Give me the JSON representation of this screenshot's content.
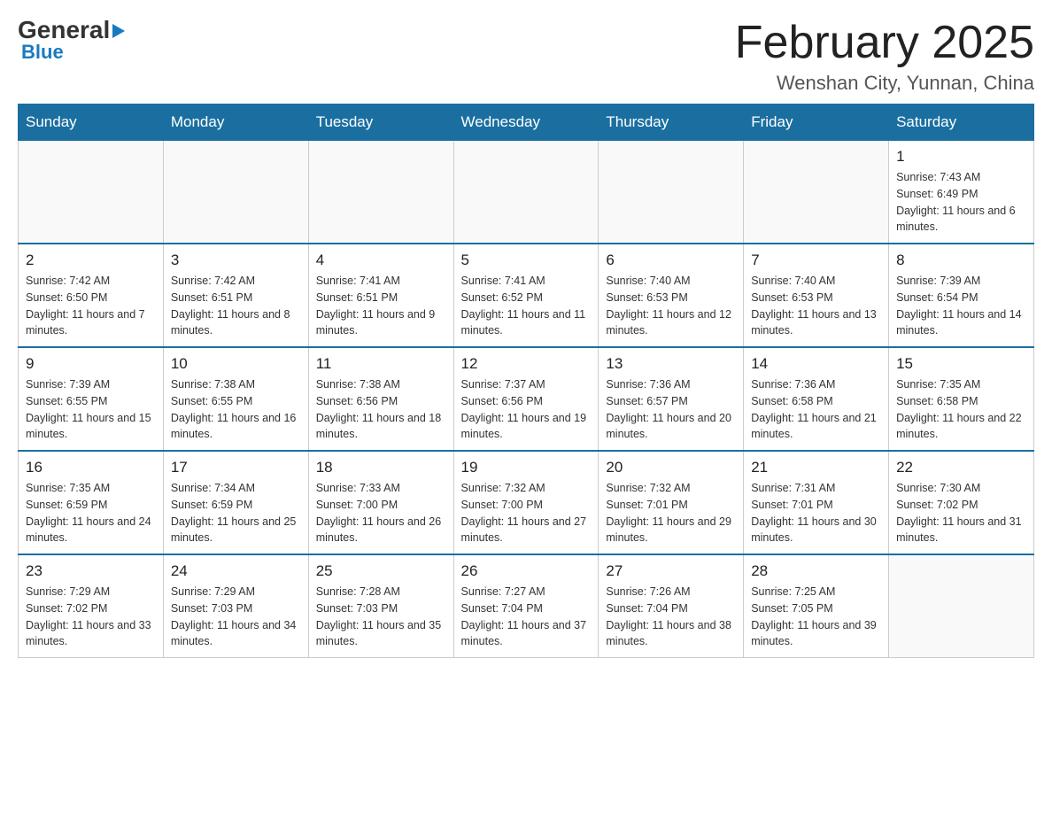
{
  "logo": {
    "general": "General",
    "blue": "Blue"
  },
  "header": {
    "month": "February 2025",
    "location": "Wenshan City, Yunnan, China"
  },
  "weekdays": [
    "Sunday",
    "Monday",
    "Tuesday",
    "Wednesday",
    "Thursday",
    "Friday",
    "Saturday"
  ],
  "weeks": [
    [
      {
        "day": "",
        "info": ""
      },
      {
        "day": "",
        "info": ""
      },
      {
        "day": "",
        "info": ""
      },
      {
        "day": "",
        "info": ""
      },
      {
        "day": "",
        "info": ""
      },
      {
        "day": "",
        "info": ""
      },
      {
        "day": "1",
        "info": "Sunrise: 7:43 AM\nSunset: 6:49 PM\nDaylight: 11 hours and 6 minutes."
      }
    ],
    [
      {
        "day": "2",
        "info": "Sunrise: 7:42 AM\nSunset: 6:50 PM\nDaylight: 11 hours and 7 minutes."
      },
      {
        "day": "3",
        "info": "Sunrise: 7:42 AM\nSunset: 6:51 PM\nDaylight: 11 hours and 8 minutes."
      },
      {
        "day": "4",
        "info": "Sunrise: 7:41 AM\nSunset: 6:51 PM\nDaylight: 11 hours and 9 minutes."
      },
      {
        "day": "5",
        "info": "Sunrise: 7:41 AM\nSunset: 6:52 PM\nDaylight: 11 hours and 11 minutes."
      },
      {
        "day": "6",
        "info": "Sunrise: 7:40 AM\nSunset: 6:53 PM\nDaylight: 11 hours and 12 minutes."
      },
      {
        "day": "7",
        "info": "Sunrise: 7:40 AM\nSunset: 6:53 PM\nDaylight: 11 hours and 13 minutes."
      },
      {
        "day": "8",
        "info": "Sunrise: 7:39 AM\nSunset: 6:54 PM\nDaylight: 11 hours and 14 minutes."
      }
    ],
    [
      {
        "day": "9",
        "info": "Sunrise: 7:39 AM\nSunset: 6:55 PM\nDaylight: 11 hours and 15 minutes."
      },
      {
        "day": "10",
        "info": "Sunrise: 7:38 AM\nSunset: 6:55 PM\nDaylight: 11 hours and 16 minutes."
      },
      {
        "day": "11",
        "info": "Sunrise: 7:38 AM\nSunset: 6:56 PM\nDaylight: 11 hours and 18 minutes."
      },
      {
        "day": "12",
        "info": "Sunrise: 7:37 AM\nSunset: 6:56 PM\nDaylight: 11 hours and 19 minutes."
      },
      {
        "day": "13",
        "info": "Sunrise: 7:36 AM\nSunset: 6:57 PM\nDaylight: 11 hours and 20 minutes."
      },
      {
        "day": "14",
        "info": "Sunrise: 7:36 AM\nSunset: 6:58 PM\nDaylight: 11 hours and 21 minutes."
      },
      {
        "day": "15",
        "info": "Sunrise: 7:35 AM\nSunset: 6:58 PM\nDaylight: 11 hours and 22 minutes."
      }
    ],
    [
      {
        "day": "16",
        "info": "Sunrise: 7:35 AM\nSunset: 6:59 PM\nDaylight: 11 hours and 24 minutes."
      },
      {
        "day": "17",
        "info": "Sunrise: 7:34 AM\nSunset: 6:59 PM\nDaylight: 11 hours and 25 minutes."
      },
      {
        "day": "18",
        "info": "Sunrise: 7:33 AM\nSunset: 7:00 PM\nDaylight: 11 hours and 26 minutes."
      },
      {
        "day": "19",
        "info": "Sunrise: 7:32 AM\nSunset: 7:00 PM\nDaylight: 11 hours and 27 minutes."
      },
      {
        "day": "20",
        "info": "Sunrise: 7:32 AM\nSunset: 7:01 PM\nDaylight: 11 hours and 29 minutes."
      },
      {
        "day": "21",
        "info": "Sunrise: 7:31 AM\nSunset: 7:01 PM\nDaylight: 11 hours and 30 minutes."
      },
      {
        "day": "22",
        "info": "Sunrise: 7:30 AM\nSunset: 7:02 PM\nDaylight: 11 hours and 31 minutes."
      }
    ],
    [
      {
        "day": "23",
        "info": "Sunrise: 7:29 AM\nSunset: 7:02 PM\nDaylight: 11 hours and 33 minutes."
      },
      {
        "day": "24",
        "info": "Sunrise: 7:29 AM\nSunset: 7:03 PM\nDaylight: 11 hours and 34 minutes."
      },
      {
        "day": "25",
        "info": "Sunrise: 7:28 AM\nSunset: 7:03 PM\nDaylight: 11 hours and 35 minutes."
      },
      {
        "day": "26",
        "info": "Sunrise: 7:27 AM\nSunset: 7:04 PM\nDaylight: 11 hours and 37 minutes."
      },
      {
        "day": "27",
        "info": "Sunrise: 7:26 AM\nSunset: 7:04 PM\nDaylight: 11 hours and 38 minutes."
      },
      {
        "day": "28",
        "info": "Sunrise: 7:25 AM\nSunset: 7:05 PM\nDaylight: 11 hours and 39 minutes."
      },
      {
        "day": "",
        "info": ""
      }
    ]
  ]
}
